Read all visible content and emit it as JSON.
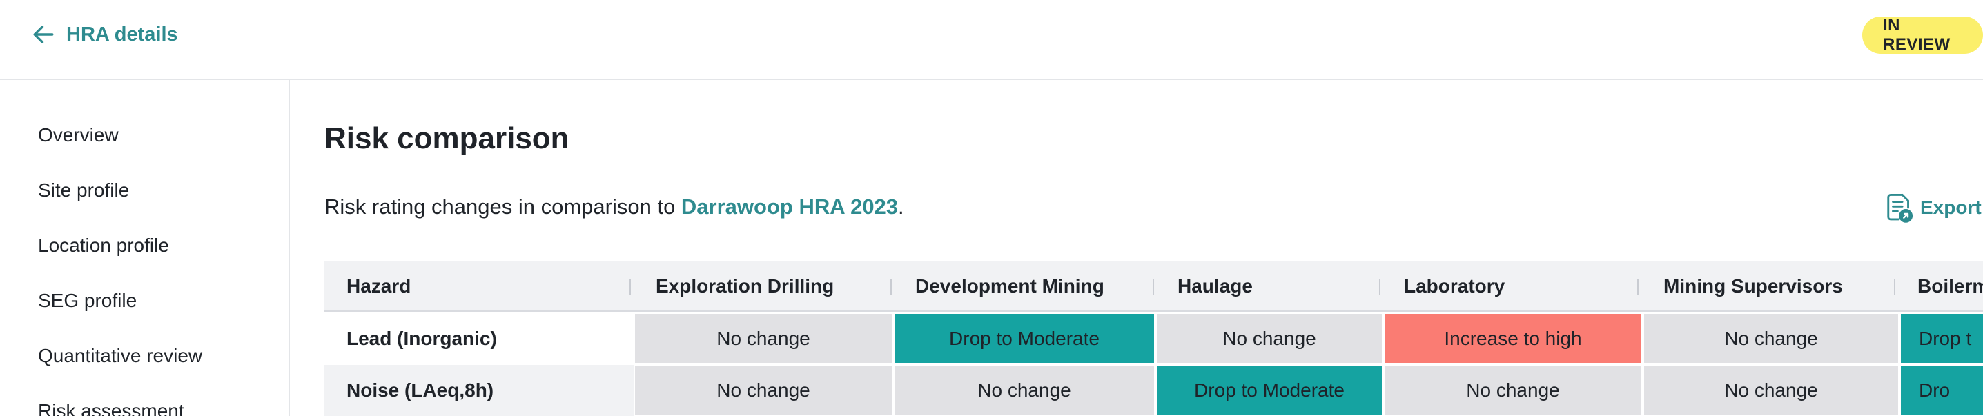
{
  "header": {
    "back_label": "HRA details",
    "status_badge": "IN REVIEW",
    "status_color": "#fbef6b"
  },
  "sidebar": {
    "items": [
      {
        "label": "Overview"
      },
      {
        "label": "Site profile"
      },
      {
        "label": "Location profile"
      },
      {
        "label": "SEG profile"
      },
      {
        "label": "Quantitative review"
      },
      {
        "label": "Risk assessment"
      }
    ]
  },
  "main": {
    "title": "Risk comparison",
    "subtitle_prefix": "Risk rating changes in comparison to ",
    "subtitle_link": "Darrawoop HRA 2023",
    "subtitle_suffix": ".",
    "export_label": "Export"
  },
  "colors": {
    "accent": "#2e8b8f",
    "no_change": "#e1e1e4",
    "drop": "#15a3a1",
    "increase": "#fa7c73"
  },
  "table": {
    "headers": [
      "Hazard",
      "Exploration Drilling",
      "Development Mining",
      "Haulage",
      "Laboratory",
      "Mining Supervisors",
      "Boilerm"
    ],
    "rows": [
      {
        "hazard": "Lead (Inorganic)",
        "cells": [
          "No change",
          "Drop to Moderate",
          "No change",
          "Increase to high",
          "No change",
          "Drop t"
        ]
      },
      {
        "hazard": "Noise (LAeq,8h)",
        "cells": [
          "No change",
          "No change",
          "Drop to Moderate",
          "No change",
          "No change",
          "Dro"
        ]
      }
    ]
  }
}
